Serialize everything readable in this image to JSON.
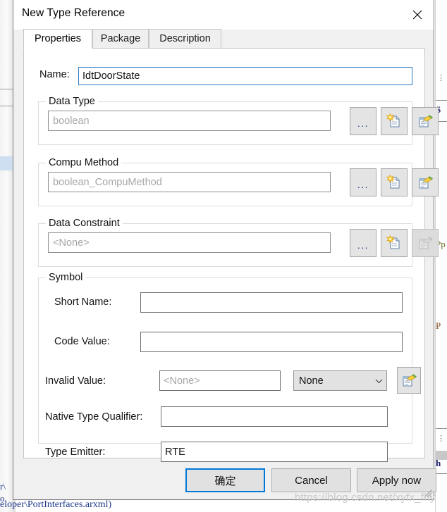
{
  "window": {
    "title": "New Type Reference",
    "close_icon": "close-icon"
  },
  "tabs": [
    {
      "label": "Properties",
      "active": true
    },
    {
      "label": "Package",
      "active": false
    },
    {
      "label": "Description",
      "active": false
    }
  ],
  "form": {
    "name": {
      "label": "Name:",
      "value": "IdtDoorState",
      "placeholder": ""
    },
    "data_type": {
      "group_title": "Data Type",
      "value": "",
      "placeholder": "boolean",
      "browse_label": "...",
      "new_icon": "new-document-icon",
      "edit_icon": "edit-document-icon"
    },
    "compu_method": {
      "group_title": "Compu Method",
      "value": "",
      "placeholder": "boolean_CompuMethod",
      "browse_label": "...",
      "new_icon": "new-document-icon",
      "edit_icon": "edit-document-icon"
    },
    "data_constraint": {
      "group_title": "Data Constraint",
      "value": "",
      "placeholder": "<None>",
      "browse_label": "...",
      "new_icon": "new-document-icon",
      "edit_icon": "edit-document-icon",
      "edit_disabled": true
    },
    "symbol": {
      "group_title": "Symbol",
      "short_name": {
        "label": "Short Name:",
        "value": "",
        "placeholder": ""
      },
      "code_value": {
        "label": "Code Value:",
        "value": "",
        "placeholder": ""
      }
    },
    "invalid_value": {
      "label": "Invalid Value:",
      "value": "",
      "placeholder": "<None>",
      "dropdown_selected": "None",
      "dropdown_options": [
        "None"
      ],
      "edit_icon": "edit-document-icon"
    },
    "native_type_qualifier": {
      "label": "Native Type Qualifier:",
      "value": "",
      "placeholder": ""
    },
    "type_emitter": {
      "label": "Type Emitter:",
      "value": "RTE",
      "placeholder": ""
    }
  },
  "buttons": {
    "ok": "确定",
    "cancel": "Cancel",
    "apply": "Apply now"
  },
  "background": {
    "bottom_path_fragment": "eloper\\PortInterfaces.arxml)",
    "left_fragment_1": "r\\",
    "left_fragment_2": "o",
    "right_fragment_s": "S",
    "right_fragment_pp": "Pp",
    "right_fragment_p": "P",
    "right_fragment_h": "h",
    "dots_1": "⋮",
    "dots_2": "⋮"
  },
  "watermark": "https://blog.csdn.net/xyfx_fhy",
  "colors": {
    "accent": "#0078d7",
    "focus_border": "#2d7cc2",
    "dialog_bg": "#f0f0f0",
    "page_bg": "#ffffff",
    "group_border": "#dcdcdc",
    "button_face": "#e1e1e1"
  }
}
